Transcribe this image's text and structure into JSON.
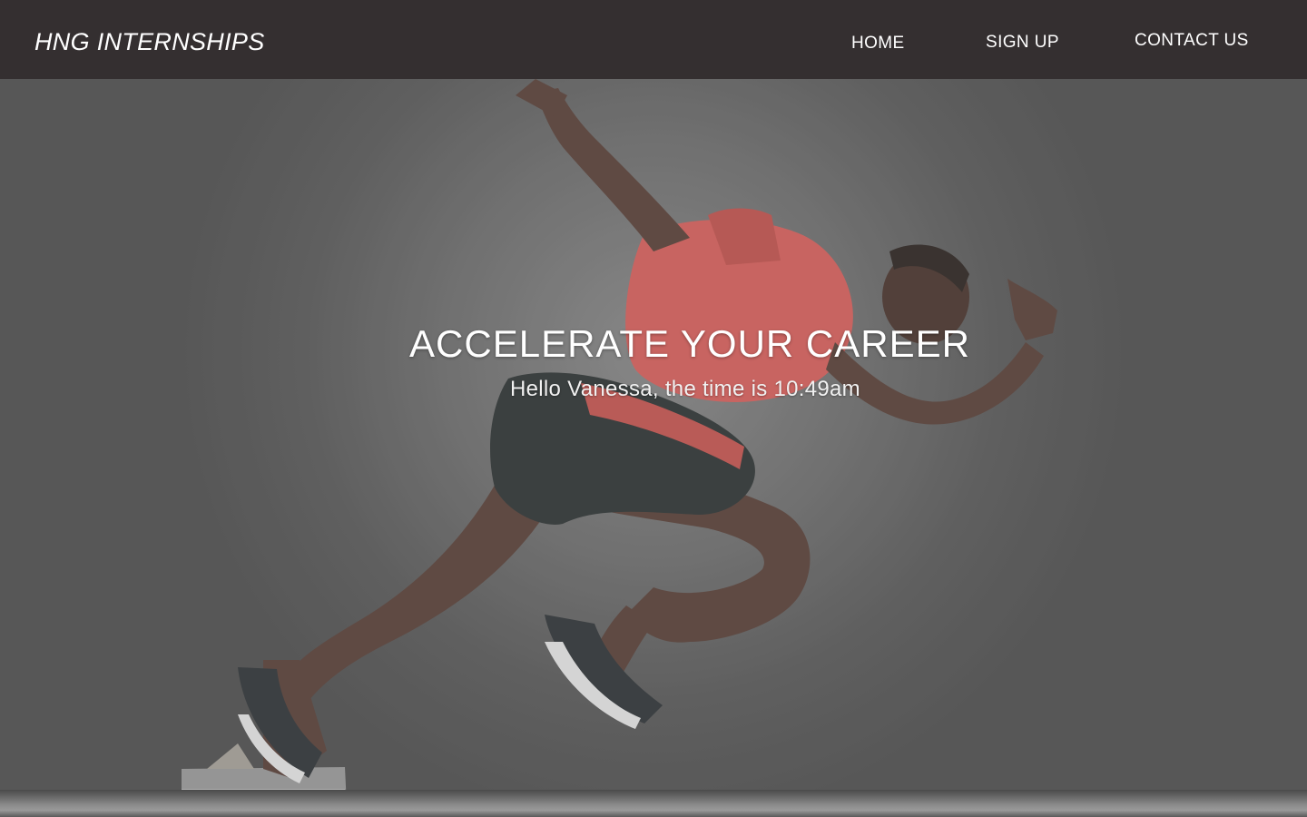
{
  "header": {
    "brand": "HNG INTERNSHIPS",
    "nav": {
      "home": "HOME",
      "sign_up": "SIGN UP",
      "contact_us": "CONTACT US"
    }
  },
  "hero": {
    "title": "ACCELERATE YOUR CAREER",
    "greeting": "Hello Vanessa, the time is 10:49am",
    "background_image": "sprinter-starting-from-blocks"
  },
  "colors": {
    "header_bg": "#342f30",
    "text": "#ffffff",
    "shirt": "#d9605c",
    "shorts": "#2e3434"
  }
}
